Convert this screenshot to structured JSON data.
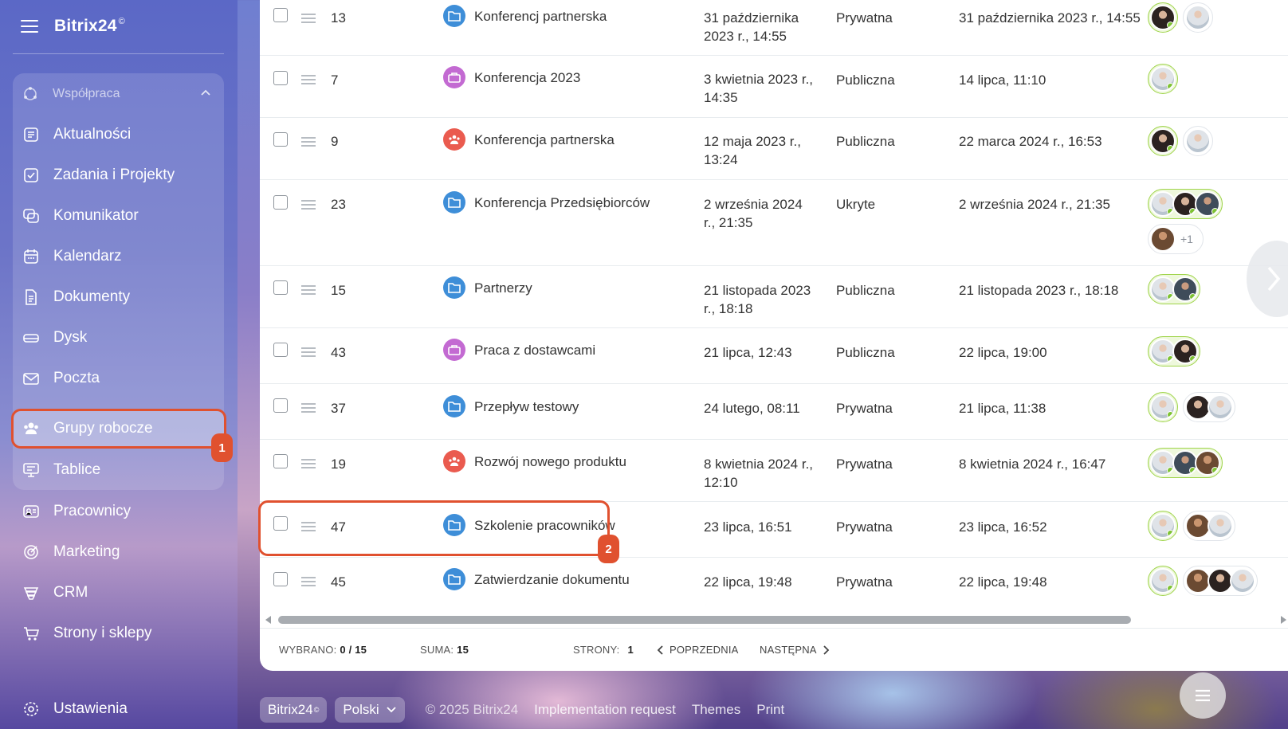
{
  "app": {
    "logo": "Bitrix24",
    "logo_mark": "©"
  },
  "sidebar": {
    "group_label": "Współpraca",
    "items": [
      {
        "label": "Aktualności",
        "icon": "news-icon"
      },
      {
        "label": "Zadania i Projekty",
        "icon": "tasks-icon"
      },
      {
        "label": "Komunikator",
        "icon": "chat-icon"
      },
      {
        "label": "Kalendarz",
        "icon": "calendar-icon"
      },
      {
        "label": "Dokumenty",
        "icon": "document-icon"
      },
      {
        "label": "Dysk",
        "icon": "drive-icon"
      },
      {
        "label": "Poczta",
        "icon": "mail-icon"
      },
      {
        "label": "Grupy robocze",
        "icon": "workgroups-icon",
        "active": true
      },
      {
        "label": "Tablice",
        "icon": "boards-icon"
      },
      {
        "label": "Pracownicy",
        "icon": "employees-icon"
      },
      {
        "label": "Marketing",
        "icon": "marketing-icon"
      },
      {
        "label": "CRM",
        "icon": "crm-icon"
      },
      {
        "label": "Strony i sklepy",
        "icon": "cart-icon"
      },
      {
        "label": "Ustawienia",
        "icon": "settings-icon"
      }
    ],
    "badge_1": "1"
  },
  "table": {
    "rows": [
      {
        "id": "13",
        "name": "Konferencj partnerska",
        "icon": "folder-icon",
        "icon_color": "#3e8ed8",
        "created": "31 października 2023 r., 14:55",
        "type": "Prywatna",
        "activity": "31 października 2023 r., 14:55"
      },
      {
        "id": "7",
        "name": "Konferencja 2023",
        "icon": "briefcase-icon",
        "icon_color": "#c36ad2",
        "created": "3 kwietnia 2023 r., 14:35",
        "type": "Publiczna",
        "activity": "14 lipca, 11:10"
      },
      {
        "id": "9",
        "name": "Konferencja partnerska",
        "icon": "people-icon",
        "icon_color": "#ea5b4f",
        "created": "12 maja 2023 r., 13:24",
        "type": "Publiczna",
        "activity": "22 marca 2024 r., 16:53"
      },
      {
        "id": "23",
        "name": "Konferencja Przedsiębiorców",
        "icon": "folder-icon",
        "icon_color": "#3e8ed8",
        "created": "2 września 2024 r., 21:35",
        "type": "Ukryte",
        "activity": "2 września 2024 r., 21:35"
      },
      {
        "id": "15",
        "name": "Partnerzy",
        "icon": "folder-icon",
        "icon_color": "#3e8ed8",
        "created": "21 listopada 2023 r., 18:18",
        "type": "Publiczna",
        "activity": "21 listopada 2023 r., 18:18"
      },
      {
        "id": "43",
        "name": "Praca z dostawcami",
        "icon": "briefcase-icon",
        "icon_color": "#c36ad2",
        "created": "21 lipca, 12:43",
        "type": "Publiczna",
        "activity": "22 lipca, 19:00"
      },
      {
        "id": "37",
        "name": "Przepływ testowy",
        "icon": "folder-icon",
        "icon_color": "#3e8ed8",
        "created": "24 lutego, 08:11",
        "type": "Prywatna",
        "activity": "21 lipca, 11:38"
      },
      {
        "id": "19",
        "name": "Rozwój nowego produktu",
        "icon": "people-icon",
        "icon_color": "#ea5b4f",
        "created": "8 kwietnia 2024 r., 12:10",
        "type": "Prywatna",
        "activity": "8 kwietnia 2024 r., 16:47"
      },
      {
        "id": "47",
        "name": "Szkolenie pracowników",
        "icon": "folder-icon",
        "icon_color": "#3e8ed8",
        "created": "23 lipca, 16:51",
        "type": "Prywatna",
        "activity": "23 lipca, 16:52"
      },
      {
        "id": "45",
        "name": "Zatwierdzanie dokumentu",
        "icon": "folder-icon",
        "icon_color": "#3e8ed8",
        "created": "22 lipca, 19:48",
        "type": "Prywatna",
        "activity": "22 lipca, 19:48"
      }
    ],
    "extra_members": "+1",
    "badge_2": "2"
  },
  "pager": {
    "selected_label": "WYBRANO:",
    "selected_value": "0 / 15",
    "sum_label": "SUMA:",
    "sum_value": "15",
    "pages_label": "STRONY:",
    "pages_value": "1",
    "prev": "POPRZEDNIA",
    "next": "NASTĘPNA"
  },
  "footer": {
    "brand": "Bitrix24",
    "brand_mark": "©",
    "language": "Polski",
    "copyright": "© 2025 Bitrix24",
    "impl": "Implementation request",
    "themes": "Themes",
    "print": "Print"
  },
  "colors": {
    "accent_red": "#e0512f",
    "online_green": "#7ec332"
  }
}
